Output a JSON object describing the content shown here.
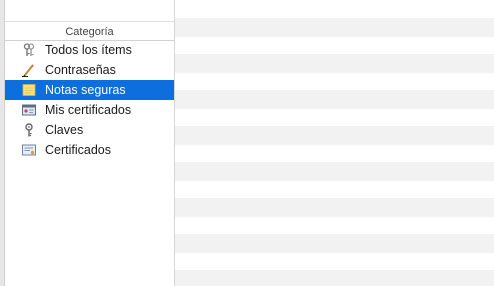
{
  "sidebar": {
    "header": "Categoría",
    "items": [
      {
        "label": "Todos los ítems",
        "icon": "keys-icon",
        "selected": false
      },
      {
        "label": "Contraseñas",
        "icon": "pencil-icon",
        "selected": false
      },
      {
        "label": "Notas seguras",
        "icon": "note-icon",
        "selected": true
      },
      {
        "label": "Mis certificados",
        "icon": "certificate-id-icon",
        "selected": false
      },
      {
        "label": "Claves",
        "icon": "key-icon",
        "selected": false
      },
      {
        "label": "Certificados",
        "icon": "certificate-icon",
        "selected": false
      }
    ]
  },
  "colors": {
    "selection": "#0d6fde",
    "stripe": "#f2f2f2"
  }
}
